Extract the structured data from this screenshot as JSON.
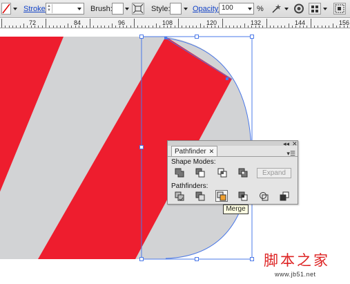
{
  "control_bar": {
    "stroke_label": "Stroke:",
    "brush_label": "Brush:",
    "style_label": "Style:",
    "opacity_label": "Opacity:",
    "opacity_value": "100",
    "percent": "%"
  },
  "ruler": {
    "labels": [
      "72",
      "84",
      "96",
      "108",
      "120",
      "132",
      "144",
      "156"
    ]
  },
  "pathfinder": {
    "tab_title": "Pathfinder",
    "shape_modes_label": "Shape Modes:",
    "expand_label": "Expand",
    "pathfinders_label": "Pathfinders:",
    "tooltip": "Merge"
  },
  "watermark": {
    "text": "脚本之家",
    "url": "www.jb51.net"
  },
  "colors": {
    "stripe_red": "#ee1d2e",
    "shape_grey": "#d2d3d5",
    "selection_blue": "#4a78e8",
    "link_blue": "#1646c9"
  }
}
